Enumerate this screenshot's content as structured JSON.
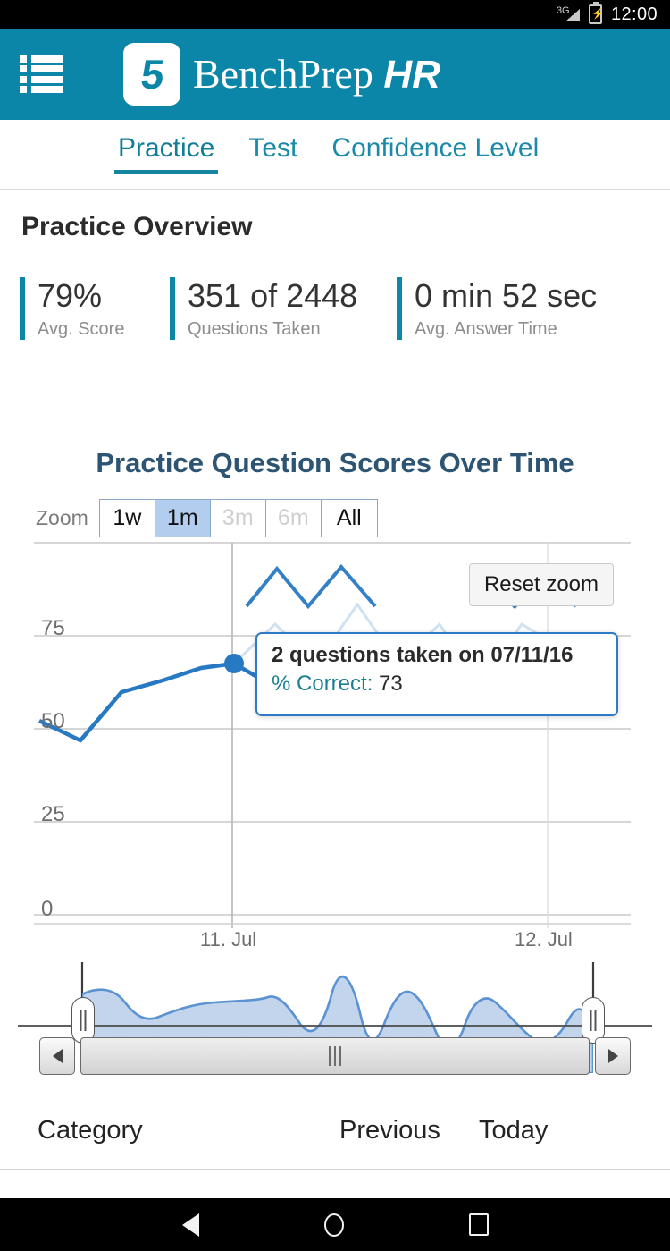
{
  "status_bar": {
    "network": "3G",
    "time": "12:00",
    "battery_icon": "battery-charging-icon"
  },
  "app_bar": {
    "menu_icon": "list-menu-icon",
    "logo_icon": "benchprep-logo-icon",
    "brand": "BenchPrep",
    "brand_suffix": "HR"
  },
  "tabs": [
    {
      "label": "Practice",
      "active": true
    },
    {
      "label": "Test",
      "active": false
    },
    {
      "label": "Confidence Level",
      "active": false
    }
  ],
  "overview": {
    "title": "Practice Overview",
    "accent_color": "#0d87a6",
    "stats": [
      {
        "value": "79%",
        "label": "Avg. Score"
      },
      {
        "value": "351 of 2448",
        "label": "Questions Taken"
      },
      {
        "value": "0 min 52 sec",
        "label": "Avg. Answer Time"
      }
    ]
  },
  "chart_panel": {
    "title": "Practice Question Scores Over Time",
    "zoom_label": "Zoom",
    "zoom_buttons": [
      {
        "label": "1w",
        "state": "enabled"
      },
      {
        "label": "1m",
        "state": "selected"
      },
      {
        "label": "3m",
        "state": "disabled"
      },
      {
        "label": "6m",
        "state": "disabled"
      },
      {
        "label": "All",
        "state": "enabled"
      }
    ],
    "reset_zoom_label": "Reset zoom",
    "tooltip": {
      "headline": "2 questions taken on 07/11/16",
      "series_key": "% Correct:",
      "series_value": "73"
    },
    "navigator": {
      "left_handle": "navigator-left-handle",
      "right_handle": "navigator-right-handle"
    },
    "scrollbar": {
      "left_arrow": "scroll-left-icon",
      "right_arrow": "scroll-right-icon",
      "grip": "scroll-grip-icon"
    }
  },
  "chart_data": {
    "type": "line",
    "title": "Practice Question Scores Over Time",
    "xlabel": "",
    "ylabel": "",
    "ylim": [
      0,
      100
    ],
    "yticks": [
      "0",
      "25",
      "50",
      "75"
    ],
    "ytick_values": [
      0,
      25,
      50,
      75
    ],
    "xticks": [
      "11. Jul",
      "12. Jul"
    ],
    "grid": true,
    "legend": "none",
    "line_color": "#2879c4",
    "marker_color": "#2879c4",
    "selected_point": {
      "x": "07/11/16",
      "y": 73,
      "questions_taken": 2
    },
    "series": [
      {
        "name": "% Correct",
        "x": [
          "",
          "",
          "",
          "",
          "11. Jul",
          "",
          "",
          "",
          "",
          "",
          "",
          "12. Jul",
          ""
        ],
        "values": [
          52,
          47,
          60,
          63,
          73,
          63,
          79,
          66,
          79,
          60,
          66,
          78,
          70
        ]
      }
    ],
    "navigator_series": {
      "name": "% Correct (overview)",
      "values": [
        70,
        72,
        62,
        63,
        66,
        67,
        66,
        68,
        58,
        50,
        52,
        77,
        40,
        44,
        70,
        48,
        52,
        68,
        46,
        42,
        40,
        45,
        60,
        56,
        44
      ]
    }
  },
  "category_table": {
    "columns": [
      "Category",
      "Previous",
      "Today"
    ]
  },
  "android_nav": {
    "back": "back-icon",
    "home": "home-icon",
    "recents": "recents-icon"
  }
}
